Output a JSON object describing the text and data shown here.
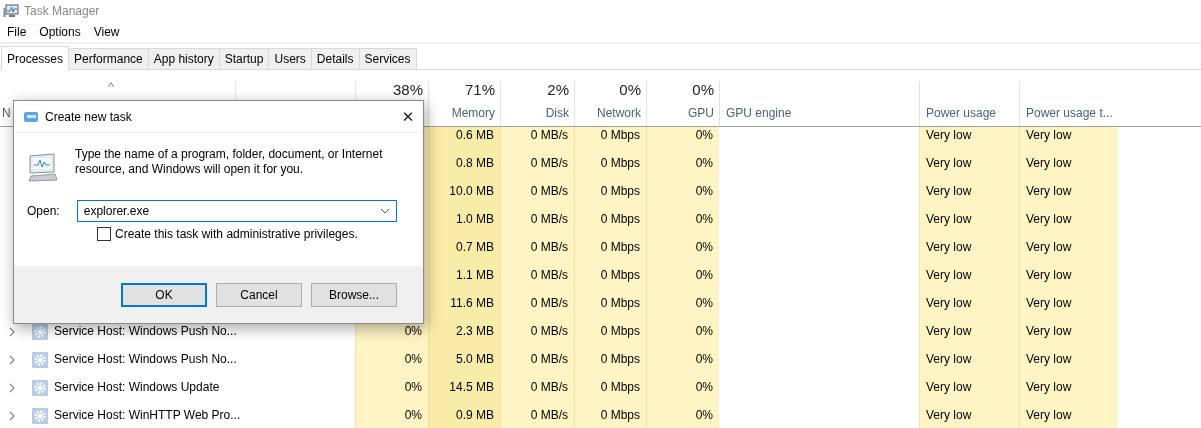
{
  "window": {
    "title": "Task Manager"
  },
  "menu": [
    "File",
    "Options",
    "View"
  ],
  "tabs": [
    {
      "label": "Processes",
      "selected": true
    },
    {
      "label": "Performance",
      "selected": false
    },
    {
      "label": "App history",
      "selected": false
    },
    {
      "label": "Startup",
      "selected": false
    },
    {
      "label": "Users",
      "selected": false
    },
    {
      "label": "Details",
      "selected": false
    },
    {
      "label": "Services",
      "selected": false
    }
  ],
  "table": {
    "sort_caret": "^",
    "columns": [
      {
        "kind": "name",
        "label": "N"
      },
      {
        "kind": "status"
      },
      {
        "kind": "cpu",
        "percent": "38%"
      },
      {
        "kind": "memory",
        "percent": "71%",
        "label": "Memory"
      },
      {
        "kind": "disk",
        "percent": "2%",
        "label": "Disk"
      },
      {
        "kind": "network",
        "percent": "0%",
        "label": "Network"
      },
      {
        "kind": "gpu",
        "percent": "0%",
        "label": "GPU"
      },
      {
        "kind": "gpu_engine",
        "label": "GPU engine"
      },
      {
        "kind": "power",
        "label": "Power usage"
      },
      {
        "kind": "power_trend",
        "label": "Power usage t..."
      }
    ],
    "rows": [
      {
        "memory": "0.6 MB",
        "disk": "0 MB/s",
        "network": "0 Mbps",
        "gpu": "0%",
        "power": "Very low",
        "power_trend": "Very low"
      },
      {
        "memory": "0.8 MB",
        "disk": "0 MB/s",
        "network": "0 Mbps",
        "gpu": "0%",
        "power": "Very low",
        "power_trend": "Very low"
      },
      {
        "memory": "10.0 MB",
        "disk": "0 MB/s",
        "network": "0 Mbps",
        "gpu": "0%",
        "power": "Very low",
        "power_trend": "Very low"
      },
      {
        "memory": "1.0 MB",
        "disk": "0 MB/s",
        "network": "0 Mbps",
        "gpu": "0%",
        "power": "Very low",
        "power_trend": "Very low"
      },
      {
        "memory": "0.7 MB",
        "disk": "0 MB/s",
        "network": "0 Mbps",
        "gpu": "0%",
        "power": "Very low",
        "power_trend": "Very low"
      },
      {
        "memory": "1.1 MB",
        "disk": "0 MB/s",
        "network": "0 Mbps",
        "gpu": "0%",
        "power": "Very low",
        "power_trend": "Very low"
      },
      {
        "memory": "11.6 MB",
        "disk": "0 MB/s",
        "network": "0 Mbps",
        "gpu": "0%",
        "power": "Very low",
        "power_trend": "Very low"
      },
      {
        "name": "Service Host: Windows Push No...",
        "cpu": "0%",
        "memory": "2.3 MB",
        "disk": "0 MB/s",
        "network": "0 Mbps",
        "gpu": "0%",
        "power": "Very low",
        "power_trend": "Very low"
      },
      {
        "name": "Service Host: Windows Push No...",
        "cpu": "0%",
        "memory": "5.0 MB",
        "disk": "0 MB/s",
        "network": "0 Mbps",
        "gpu": "0%",
        "power": "Very low",
        "power_trend": "Very low"
      },
      {
        "name": "Service Host: Windows Update",
        "cpu": "0%",
        "memory": "14.5 MB",
        "disk": "0 MB/s",
        "network": "0 Mbps",
        "gpu": "0%",
        "power": "Very low",
        "power_trend": "Very low"
      },
      {
        "name": "Service Host: WinHTTP Web Pro...",
        "cpu": "0%",
        "memory": "0.9 MB",
        "disk": "0 MB/s",
        "network": "0 Mbps",
        "gpu": "0%",
        "power": "Very low",
        "power_trend": "Very low"
      }
    ]
  },
  "dialog": {
    "title": "Create new task",
    "close": "✕",
    "message": "Type the name of a program, folder, document, or Internet resource, and Windows will open it for you.",
    "open_label": "Open:",
    "open_value": "explorer.exe",
    "admin_checkbox": {
      "label": "Create this task with administrative privileges.",
      "checked": false
    },
    "buttons": [
      {
        "label": "OK",
        "selected": true
      },
      {
        "label": "Cancel",
        "selected": false
      },
      {
        "label": "Browse...",
        "selected": false
      }
    ]
  }
}
